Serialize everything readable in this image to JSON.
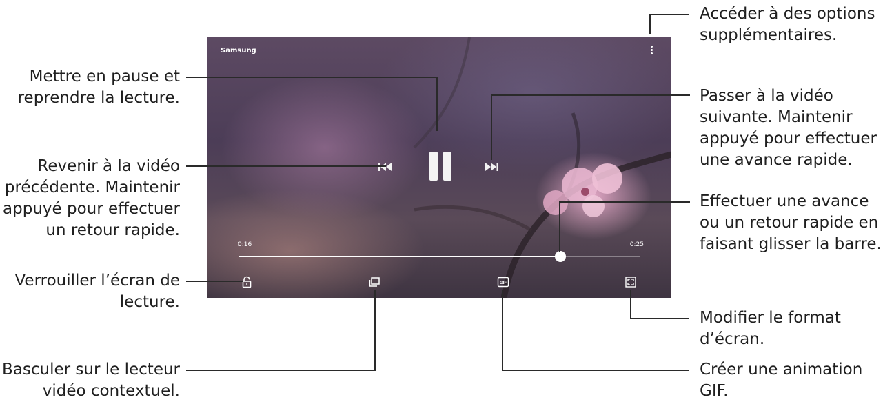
{
  "player": {
    "title": "Samsung",
    "time_elapsed": "0:16",
    "time_total": "0:25",
    "progress": 0.8,
    "icons": {
      "more": "more-options-icon",
      "previous": "previous-video-icon",
      "pause": "pause-icon",
      "next": "next-video-icon",
      "lock": "lock-icon",
      "popup": "popup-player-icon",
      "gif": "gif-icon",
      "ratio": "screen-ratio-icon"
    },
    "gif_text": "GIF"
  },
  "annotations": {
    "more_options": [
      "Accéder à des options",
      "supplémentaires."
    ],
    "pause_resume": [
      "Mettre en pause et",
      "reprendre la lecture."
    ],
    "next_video": [
      "Passer à la vidéo",
      "suivante. Maintenir",
      "appuyé pour effectuer",
      "une avance rapide."
    ],
    "previous_video": [
      "Revenir à la vidéo",
      "précédente. Maintenir",
      "appuyé pour effectuer",
      "un retour rapide."
    ],
    "seek_bar": [
      "Effectuer une avance",
      "ou un retour rapide en",
      "faisant glisser la barre."
    ],
    "lock_screen": [
      "Verrouiller l’écran de",
      "lecture."
    ],
    "screen_ratio": [
      "Modifier le format",
      "d’écran."
    ],
    "popup_player": [
      "Basculer sur le lecteur",
      "vidéo contextuel."
    ],
    "gif_animation": [
      "Créer une animation",
      "GIF."
    ]
  }
}
